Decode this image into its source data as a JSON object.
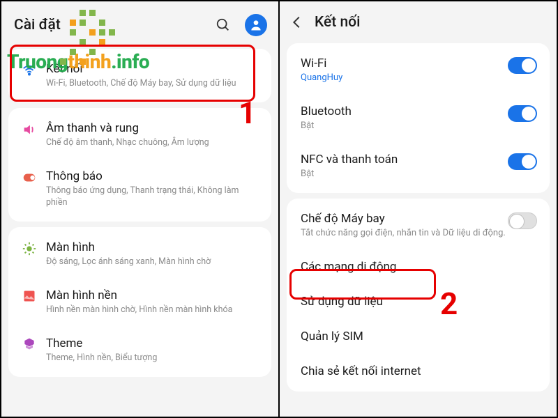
{
  "left": {
    "header": {
      "title": "Cài đặt"
    },
    "cards": [
      {
        "rows": [
          {
            "icon": "wifi",
            "title": "Kết nối",
            "sub": "Wi-Fi, Bluetooth, Chế độ Máy bay, Sử dụng dữ liệu"
          }
        ]
      },
      {
        "rows": [
          {
            "icon": "sound",
            "title": "Âm thanh và rung",
            "sub": "Chế độ âm thanh, Nhạc chuông, Âm lượng"
          },
          {
            "icon": "notif",
            "title": "Thông báo",
            "sub": "Thông báo ứng dụng, Thanh trạng thái, Không làm phiền"
          }
        ]
      },
      {
        "rows": [
          {
            "icon": "display",
            "title": "Màn hình",
            "sub": "Độ sáng, Lọc ánh sáng xanh, Màn hình chờ"
          },
          {
            "icon": "wallpaper",
            "title": "Màn hình nền",
            "sub": "Hình nền màn hình chờ, Hình nền màn hình khóa"
          },
          {
            "icon": "theme",
            "title": "Theme",
            "sub": "Theme, Hình nền, Biểu tượng"
          }
        ]
      }
    ]
  },
  "right": {
    "header": {
      "title": "Kết nối"
    },
    "cards": [
      {
        "rows": [
          {
            "title": "Wi-Fi",
            "sub": "QuangHuy",
            "subStyle": "blue",
            "toggle": "on"
          },
          {
            "title": "Bluetooth",
            "sub": "Bật",
            "toggle": "on"
          },
          {
            "title": "NFC và thanh toán",
            "sub": "Bật",
            "toggle": "on"
          }
        ]
      },
      {
        "rows": [
          {
            "title": "Chế độ Máy bay",
            "sub": "Tắt chức năng gọi điện, nhắn tin và Dữ liệu di động.",
            "toggle": "off"
          },
          {
            "title": "Các mạng di động"
          },
          {
            "title": "Sử dụng dữ liệu"
          },
          {
            "title": "Quản lý SIM"
          },
          {
            "title": "Chia sẻ kết nối internet"
          }
        ]
      }
    ]
  },
  "annotations": {
    "num1": "1",
    "num2": "2"
  },
  "watermark": {
    "t1a": "Truong",
    "t1b": "thinh",
    "t1c": ".info"
  }
}
